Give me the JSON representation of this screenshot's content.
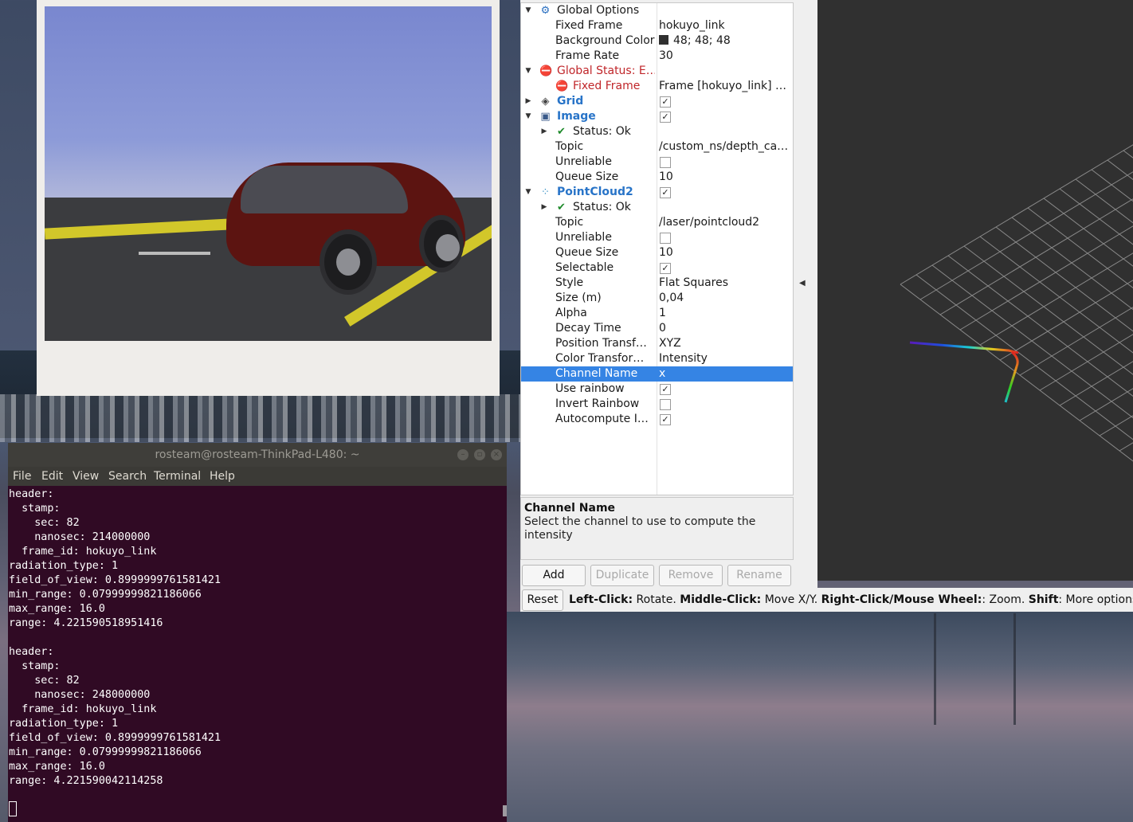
{
  "image_panel": {},
  "terminal": {
    "title": "rosteam@rosteam-ThinkPad-L480: ~",
    "menu": [
      "File",
      "Edit",
      "View",
      "Search",
      "Terminal",
      "Help"
    ],
    "output": "header:\n  stamp:\n    sec: 82\n    nanosec: 214000000\n  frame_id: hokuyo_link\nradiation_type: 1\nfield_of_view: 0.8999999761581421\nmin_range: 0.07999999821186066\nmax_range: 16.0\nrange: 4.221590518951416\n\nheader:\n  stamp:\n    sec: 82\n    nanosec: 248000000\n  frame_id: hokuyo_link\nradiation_type: 1\nfield_of_view: 0.8999999761581421\nmin_range: 0.07999999821186066\nmax_range: 16.0\nrange: 4.221590042114258"
  },
  "rviz": {
    "tree": [
      {
        "name": "Global Options",
        "value": "",
        "style": "normal",
        "arrow": "down",
        "icon": "gear-icon",
        "level": 0
      },
      {
        "name": "Fixed Frame",
        "value": "hokuyo_link",
        "style": "normal",
        "level": 1
      },
      {
        "name": "Background Color",
        "value": "48; 48; 48",
        "style": "normal",
        "level": 1,
        "swatch": "#303030"
      },
      {
        "name": "Frame Rate",
        "value": "30",
        "style": "normal",
        "level": 1
      },
      {
        "name": "Global Status: E…",
        "value": "",
        "style": "err",
        "arrow": "down",
        "icon": "error-icon",
        "level": 0
      },
      {
        "name": "Fixed Frame",
        "value": "Frame [hokuyo_link] …",
        "style": "err",
        "icon": "error-icon",
        "level": 1
      },
      {
        "name": "Grid",
        "value": "",
        "style": "bold",
        "arrow": "right",
        "icon": "grid-icon",
        "level": 0,
        "checked": true
      },
      {
        "name": "Image",
        "value": "",
        "style": "bold",
        "arrow": "down",
        "icon": "image-icon",
        "level": 0,
        "checked": true
      },
      {
        "name": "Status: Ok",
        "value": "",
        "style": "normal",
        "arrow": "right",
        "icon": "checkmark-icon",
        "level": 1
      },
      {
        "name": "Topic",
        "value": "/custom_ns/depth_ca…",
        "style": "normal",
        "level": 1
      },
      {
        "name": "Unreliable",
        "value": "",
        "style": "normal",
        "level": 1,
        "checked": false
      },
      {
        "name": "Queue Size",
        "value": "10",
        "style": "normal",
        "level": 1
      },
      {
        "name": "PointCloud2",
        "value": "",
        "style": "bold",
        "arrow": "down",
        "icon": "pointcloud-icon",
        "level": 0,
        "checked": true
      },
      {
        "name": "Status: Ok",
        "value": "",
        "style": "normal",
        "arrow": "right",
        "icon": "checkmark-icon",
        "level": 1
      },
      {
        "name": "Topic",
        "value": "/laser/pointcloud2",
        "style": "normal",
        "level": 1
      },
      {
        "name": "Unreliable",
        "value": "",
        "style": "normal",
        "level": 1,
        "checked": false
      },
      {
        "name": "Queue Size",
        "value": "10",
        "style": "normal",
        "level": 1
      },
      {
        "name": "Selectable",
        "value": "",
        "style": "normal",
        "level": 1,
        "checked": true
      },
      {
        "name": "Style",
        "value": "Flat Squares",
        "style": "normal",
        "level": 1
      },
      {
        "name": "Size (m)",
        "value": "0,04",
        "style": "normal",
        "level": 1
      },
      {
        "name": "Alpha",
        "value": "1",
        "style": "normal",
        "level": 1
      },
      {
        "name": "Decay Time",
        "value": "0",
        "style": "normal",
        "level": 1
      },
      {
        "name": "Position Transf…",
        "value": "XYZ",
        "style": "normal",
        "level": 1
      },
      {
        "name": "Color Transfor…",
        "value": "Intensity",
        "style": "normal",
        "level": 1
      },
      {
        "name": "Channel Name",
        "value": "x",
        "style": "normal",
        "level": 1,
        "selected": true
      },
      {
        "name": "Use rainbow",
        "value": "",
        "style": "normal",
        "level": 1,
        "checked": true
      },
      {
        "name": "Invert Rainbow",
        "value": "",
        "style": "normal",
        "level": 1,
        "checked": false
      },
      {
        "name": "Autocompute I…",
        "value": "",
        "style": "normal",
        "level": 1,
        "checked": true
      }
    ],
    "description": {
      "title": "Channel Name",
      "text": "Select the channel to use to compute the intensity"
    },
    "buttons": {
      "add": "Add",
      "duplicate": "Duplicate",
      "remove": "Remove",
      "rename": "Rename"
    },
    "reset": "Reset",
    "status": {
      "left_click": "Left-Click:",
      "rotate": " Rotate. ",
      "middle_click": "Middle-Click:",
      "move": " Move X/Y. ",
      "right_click": "Right-Click/Mouse Wheel:",
      "zoom": ": Zoom. ",
      "shift": "Shift",
      "more": ": More options."
    }
  }
}
